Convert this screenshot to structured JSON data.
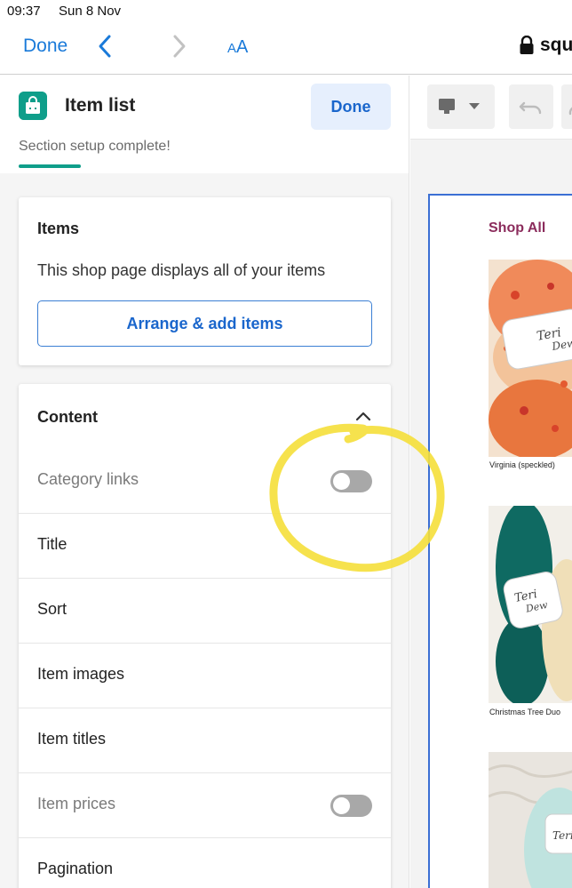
{
  "status_bar": {
    "time": "09:37",
    "date": "Sun 8 Nov"
  },
  "browser": {
    "done_label": "Done",
    "text_size_small": "A",
    "text_size_large": "A",
    "url": "squ",
    "icons": [
      "back-chevron",
      "forward-chevron",
      "lock"
    ]
  },
  "panel": {
    "title": "Item list",
    "done_label": "Done",
    "setup_status": "Section setup complete!",
    "accent_color": "#0f9e8a",
    "items_card": {
      "title": "Items",
      "description": "This shop page displays all of your items",
      "button_label": "Arrange & add items"
    },
    "content_card": {
      "title": "Content",
      "rows": [
        {
          "label": "Category links",
          "toggle": "off"
        },
        {
          "label": "Title"
        },
        {
          "label": "Sort"
        },
        {
          "label": "Item images"
        },
        {
          "label": "Item titles"
        },
        {
          "label": "Item prices",
          "toggle": "off"
        },
        {
          "label": "Pagination"
        }
      ]
    }
  },
  "preview": {
    "heading": "Shop All",
    "heading_color": "#8b2c5c",
    "products": [
      {
        "name": "Virginia (speckled)",
        "image": "orange speckled yarn skein"
      },
      {
        "name": "Christmas Tree Duo",
        "image": "teal yarn skeins"
      },
      {
        "name": "",
        "image": "pale aqua yarn skein"
      }
    ]
  },
  "annotation": {
    "color": "#f5df3a",
    "shape": "hand-drawn circle around Category links toggle"
  }
}
